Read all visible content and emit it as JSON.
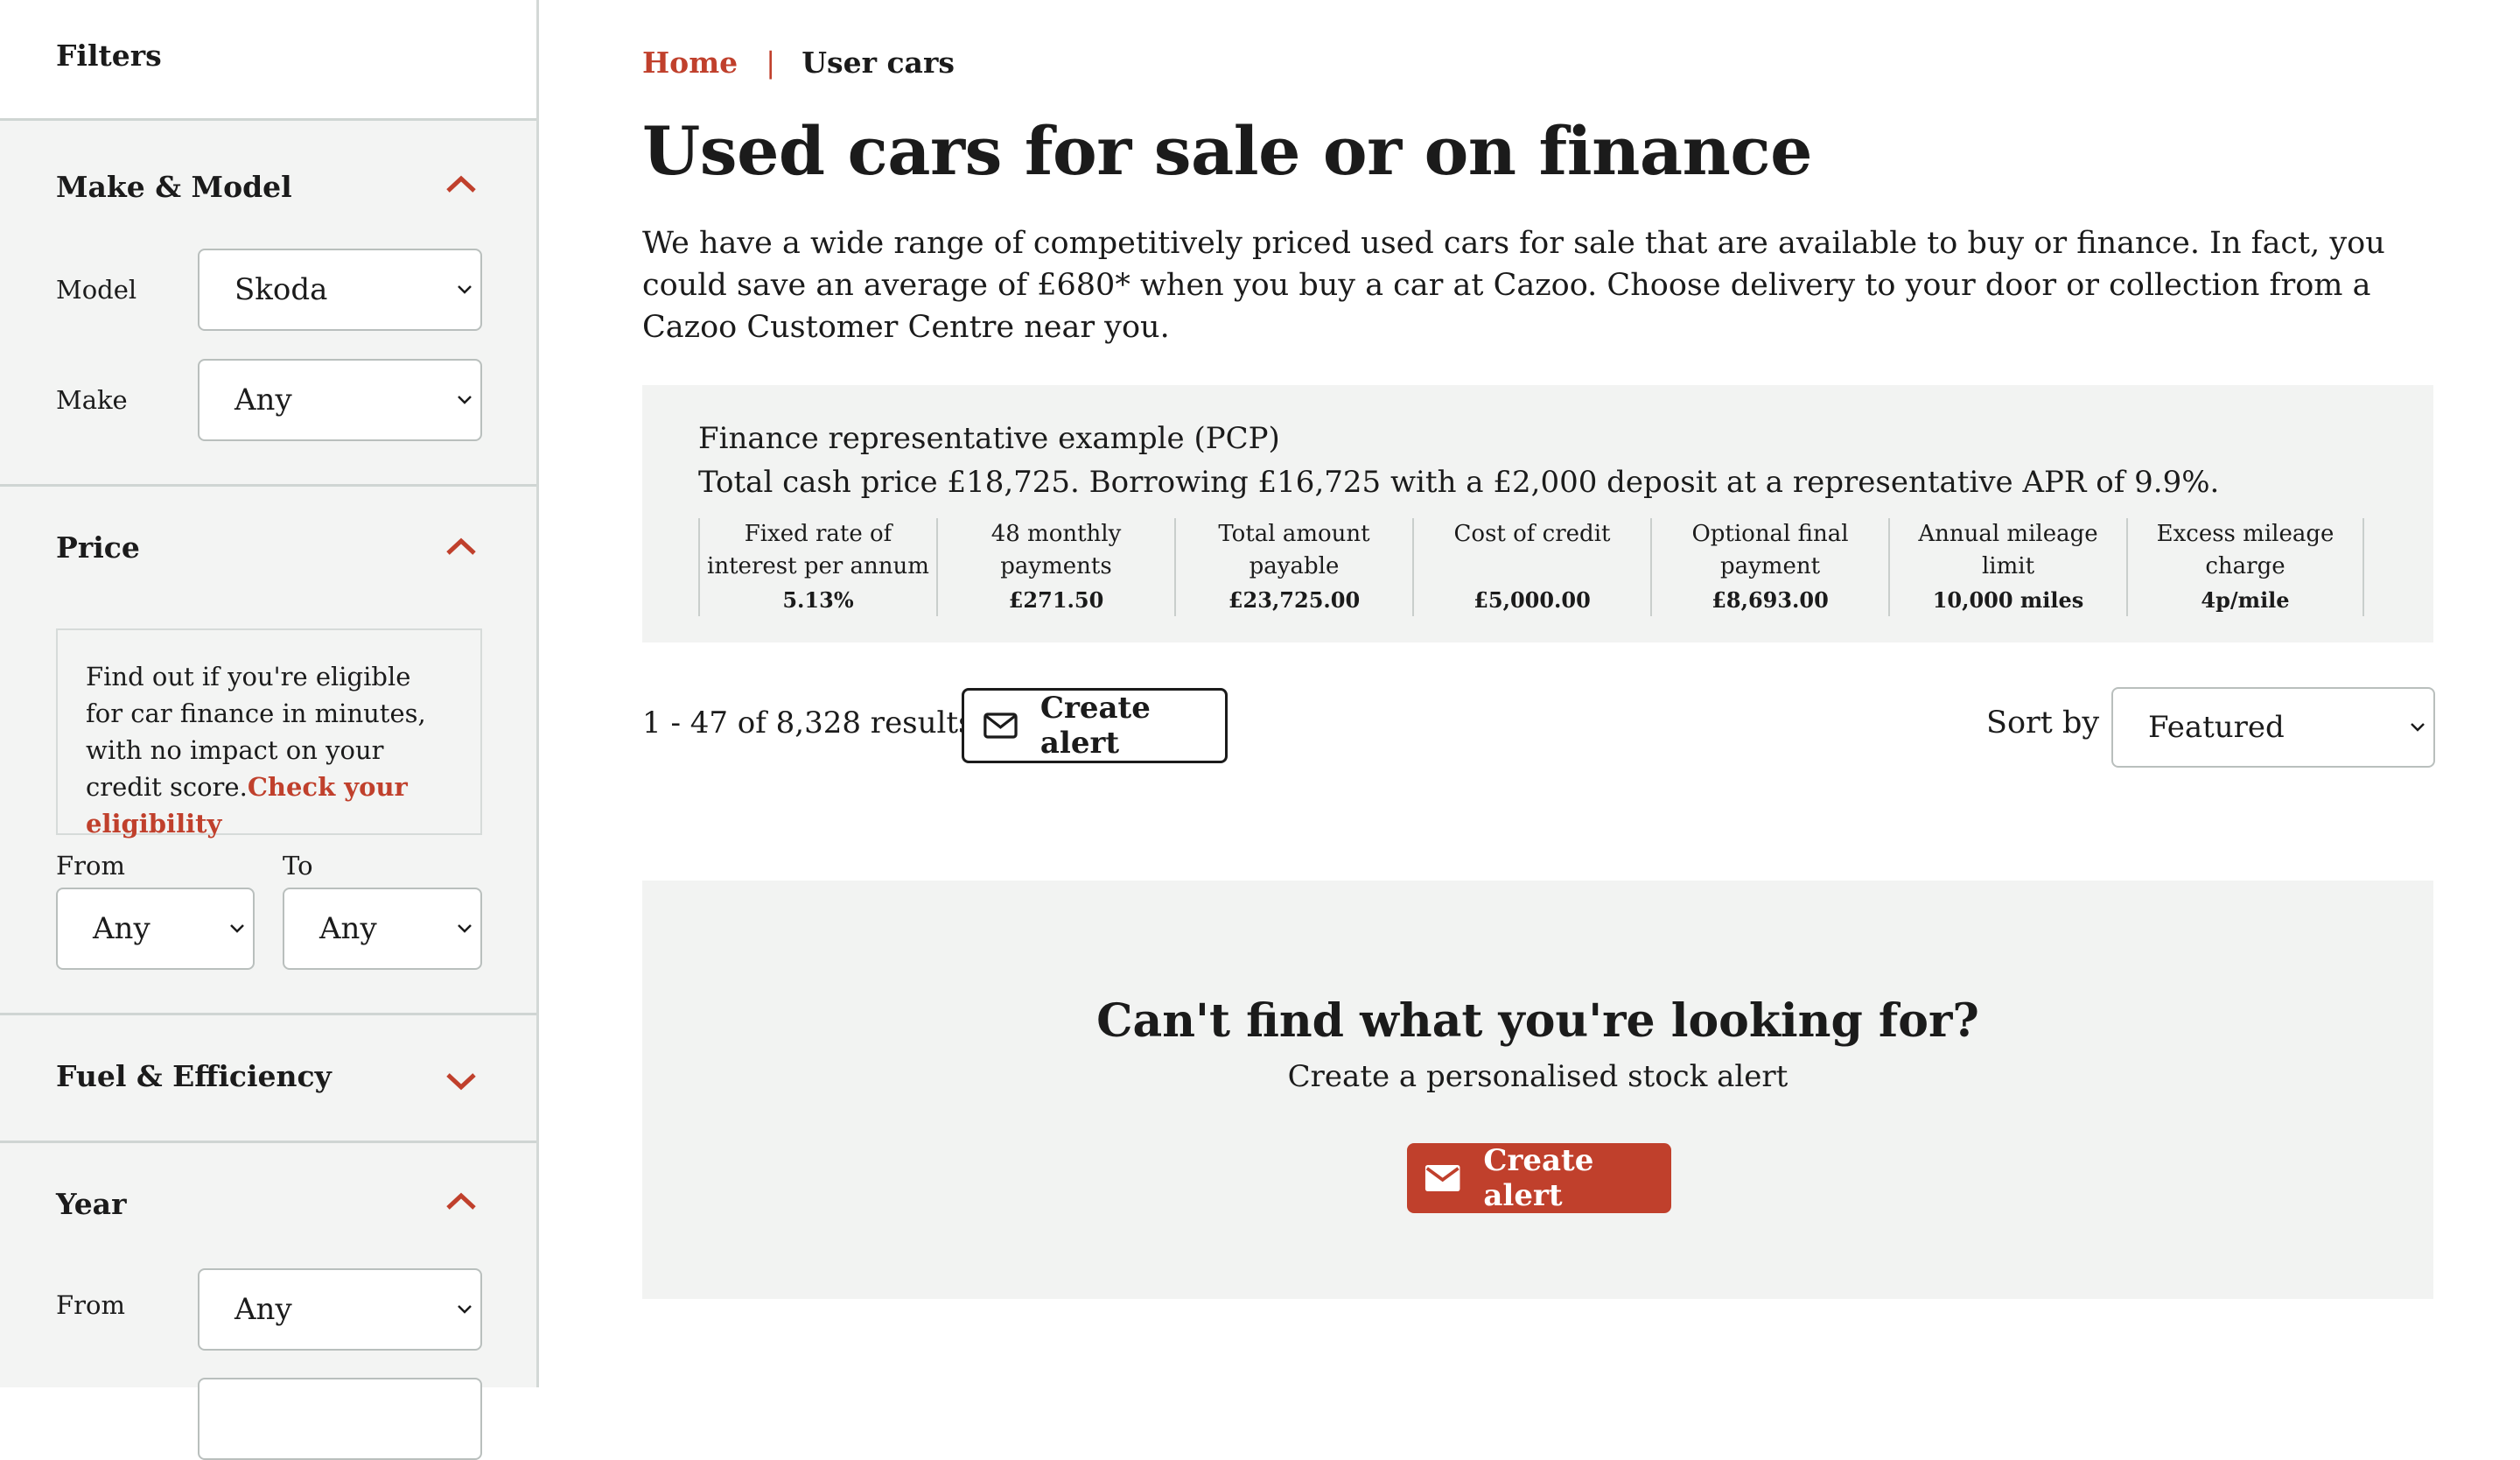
{
  "sidebar": {
    "title": "Filters",
    "make_model": {
      "title": "Make & Model",
      "model_label": "Model",
      "model_value": "Skoda",
      "make_label": "Make",
      "make_value": "Any"
    },
    "price": {
      "title": "Price",
      "info_text": "Find out if you're eligible for car finance in minutes, with no impact on your credit score.",
      "info_link": "Check your eligibility",
      "from_label": "From",
      "from_value": "Any",
      "to_label": "To",
      "to_value": "Any"
    },
    "fuel": {
      "title": "Fuel & Efficiency"
    },
    "year": {
      "title": "Year",
      "from_label": "From",
      "from_value": "Any"
    }
  },
  "breadcrumb": {
    "home": "Home",
    "separator": "|",
    "current": "User cars"
  },
  "page": {
    "title": "Used cars for sale or on finance",
    "intro": "We have a wide range of competitively priced used cars for sale that are available to buy or finance. In fact, you could save an average of £680* when you buy a car at Cazoo. Choose delivery to your door or collection from a Cazoo Customer Centre near you."
  },
  "finance": {
    "heading": "Finance representative example (PCP)",
    "summary": "Total cash price £18,725. Borrowing £16,725 with a £2,000 deposit at a representative APR of 9.9%.",
    "columns": [
      {
        "label": "Fixed rate of interest per annum",
        "value": "5.13%"
      },
      {
        "label": "48 monthly payments",
        "value": "£271.50"
      },
      {
        "label": "Total amount payable",
        "value": "£23,725.00"
      },
      {
        "label": "Cost of credit",
        "value": "£5,000.00"
      },
      {
        "label": "Optional final payment",
        "value": "£8,693.00"
      },
      {
        "label": "Annual mileage limit",
        "value": "10,000 miles"
      },
      {
        "label": "Excess mileage charge",
        "value": "4p/mile"
      }
    ]
  },
  "results": {
    "count_text": "1 - 47 of 8,328 results",
    "create_alert": "Create alert",
    "sort_label": "Sort by",
    "sort_value": "Featured"
  },
  "cta": {
    "heading": "Can't find what you're looking for?",
    "subheading": "Create a personalised stock alert",
    "button": "Create alert"
  },
  "colors": {
    "accent": "#c0402c",
    "panel": "#f2f3f2",
    "text": "#1b1b1b"
  }
}
